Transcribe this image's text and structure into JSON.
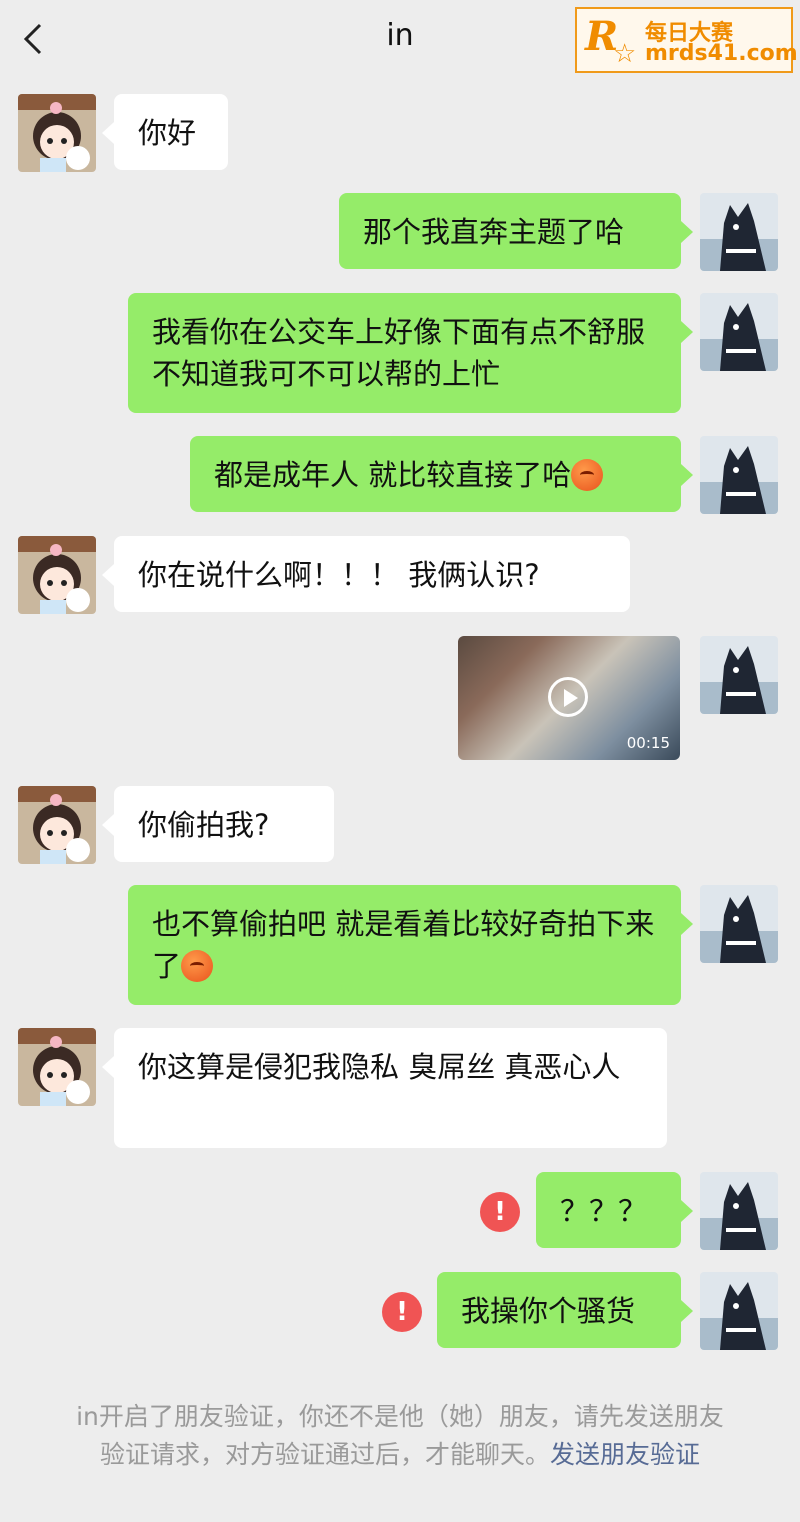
{
  "header": {
    "title": "in",
    "more": "..."
  },
  "watermark": {
    "logo_letter": "R",
    "line1": "每日大赛",
    "line2": "mrds41.com"
  },
  "messages": [
    {
      "side": "in",
      "text": "你好"
    },
    {
      "side": "out",
      "text": "那个我直奔主题了哈"
    },
    {
      "side": "out",
      "text": "我看你在公交车上好像下面有点不舒服 不知道我可不可以帮的上忙"
    },
    {
      "side": "out",
      "text": "都是成年人 就比较直接了哈"
    },
    {
      "side": "in",
      "text": "你在说什么啊！！！ 我俩认识?"
    },
    {
      "side": "out",
      "type": "video",
      "duration": "00:15"
    },
    {
      "side": "in",
      "text": "你偷拍我?"
    },
    {
      "side": "out",
      "text": "也不算偷拍吧 就是看着比较好奇拍下来了"
    },
    {
      "side": "in",
      "text": "你这算是侵犯我隐私 臭屌丝 真恶心人"
    },
    {
      "side": "out",
      "text": "？？？",
      "status": "failed"
    },
    {
      "side": "out",
      "text": "我操你个骚货",
      "status": "failed"
    }
  ],
  "system_notice": {
    "text": "in开启了朋友验证，你还不是他（她）朋友，请先发送朋友验证请求，对方验证通过后，才能聊天。",
    "link": "发送朋友验证"
  },
  "colors": {
    "background": "#ededed",
    "outgoing_bubble": "#95ec69",
    "incoming_bubble": "#ffffff",
    "link": "#576b95",
    "error": "#f05454"
  },
  "icons": {
    "back": "chevron-left-icon",
    "more": "more-dots-icon",
    "error": "exclamation-icon",
    "play": "play-icon",
    "emoji": "sweat-emoji-icon"
  }
}
